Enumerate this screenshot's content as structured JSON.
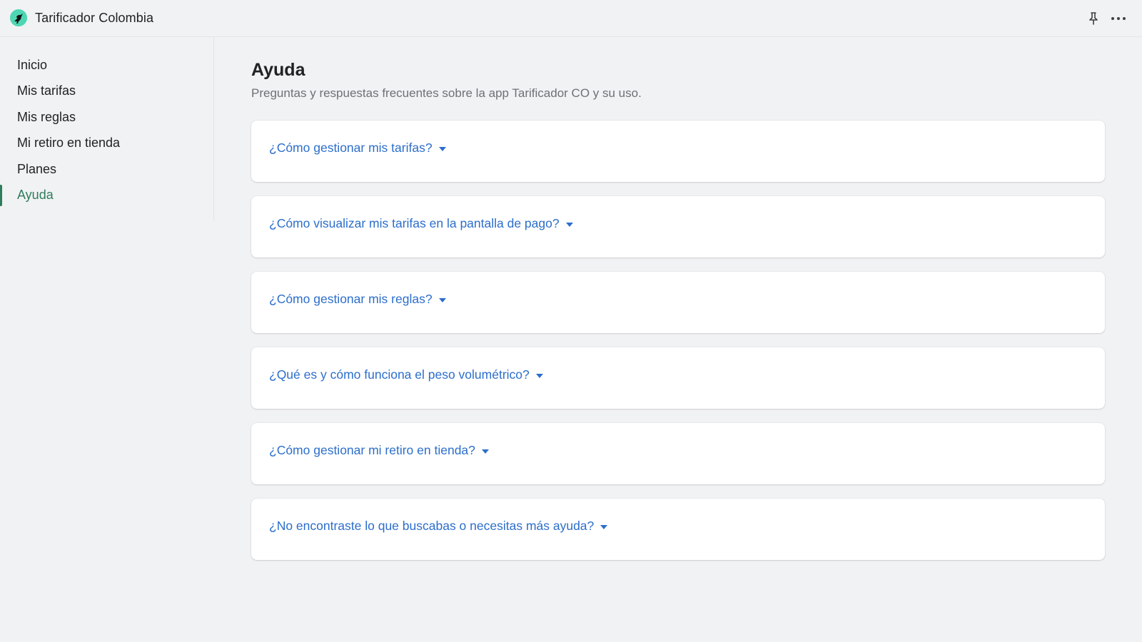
{
  "app": {
    "title": "Tarificador Colombia",
    "logo_icon": "bird-logo-icon",
    "accent_color": "#2e7d5b",
    "link_color": "#2c6ecb"
  },
  "topbar": {
    "pin_icon": "pin-icon",
    "more_icon": "more-horizontal-icon"
  },
  "sidebar": {
    "items": [
      {
        "label": "Inicio",
        "active": false
      },
      {
        "label": "Mis tarifas",
        "active": false
      },
      {
        "label": "Mis reglas",
        "active": false
      },
      {
        "label": "Mi retiro en tienda",
        "active": false
      },
      {
        "label": "Planes",
        "active": false
      },
      {
        "label": "Ayuda",
        "active": true
      }
    ]
  },
  "main": {
    "title": "Ayuda",
    "subtitle": "Preguntas y respuestas frecuentes sobre la app Tarificador CO y su uso.",
    "faqs": [
      {
        "question": "¿Cómo gestionar mis tarifas?"
      },
      {
        "question": "¿Cómo visualizar mis tarifas en la pantalla de pago?"
      },
      {
        "question": "¿Cómo gestionar mis reglas?"
      },
      {
        "question": "¿Qué es y cómo funciona el peso volumétrico?"
      },
      {
        "question": "¿Cómo gestionar mi retiro en tienda?"
      },
      {
        "question": "¿No encontraste lo que buscabas o necesitas más ayuda?"
      }
    ]
  }
}
